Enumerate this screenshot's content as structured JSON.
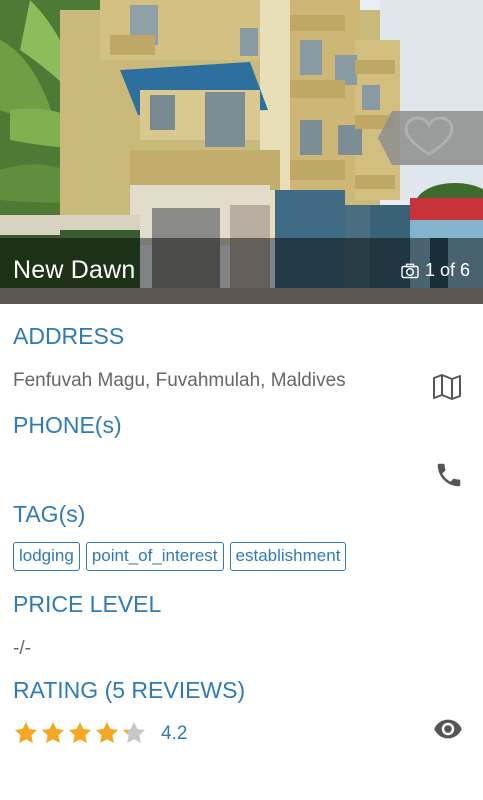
{
  "place": {
    "name": "New Dawn",
    "photo_counter": "1 of 6"
  },
  "sections": {
    "address_title": "ADDRESS",
    "address_value": "Fenfuvah Magu, Fuvahmulah, Maldives",
    "phone_title": "PHONE(s)",
    "tags_title": "TAG(s)",
    "tags": [
      "lodging",
      "point_of_interest",
      "establishment"
    ],
    "price_title": "PRICE LEVEL",
    "price_value": "-/-",
    "rating_title": "RATING (5 REVIEWS)",
    "rating_value": "4.2",
    "rating_stars": 4.2,
    "rating_max": 5
  },
  "colors": {
    "accent": "#2e7bb8",
    "star_filled": "#f5a623",
    "star_empty": "#c8c8c8",
    "icon_gray": "#555555"
  },
  "icons": {
    "favorite": "heart-icon",
    "photos": "camera-icon",
    "map": "map-icon",
    "phone": "phone-icon",
    "reviews": "eye-icon"
  }
}
